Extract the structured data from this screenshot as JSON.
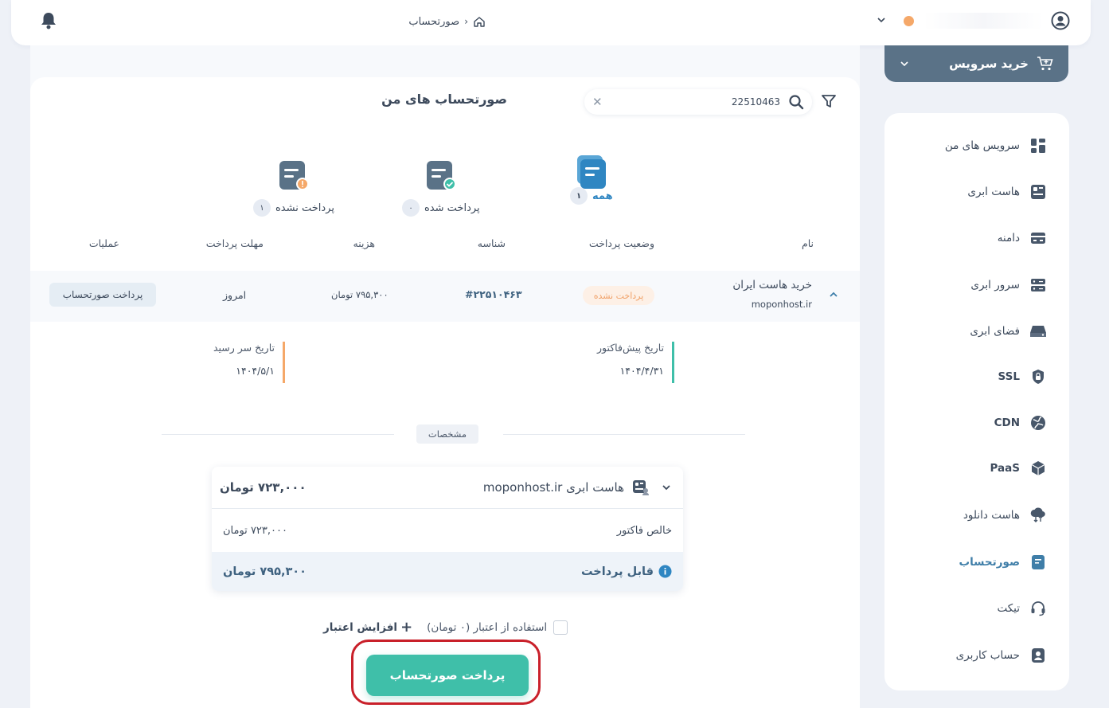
{
  "breadcrumb": {
    "current": "صورتحساب"
  },
  "buy": {
    "label": "خرید سرویس"
  },
  "sidebar": {
    "items": [
      {
        "label": "سرویس های من"
      },
      {
        "label": "هاست ابری"
      },
      {
        "label": "دامنه"
      },
      {
        "label": "سرور ابری"
      },
      {
        "label": "فضای ابری"
      },
      {
        "label": "SSL"
      },
      {
        "label": "CDN"
      },
      {
        "label": "PaaS"
      },
      {
        "label": "هاست دانلود"
      },
      {
        "label": "صورتحساب"
      },
      {
        "label": "تیکت"
      },
      {
        "label": "حساب کاربری"
      }
    ]
  },
  "main": {
    "title": "صورتحساب های من",
    "search_value": "22510463",
    "tabs": [
      {
        "label": "همه",
        "count": "۱"
      },
      {
        "label": "پرداخت شده",
        "count": "۰"
      },
      {
        "label": "پرداخت نشده",
        "count": "۱"
      }
    ],
    "columns": {
      "name": "نام",
      "status": "وضعیت پرداخت",
      "id": "شناسه",
      "cost": "هزینه",
      "deadline": "مهلت پرداخت",
      "actions": "عملیات"
    },
    "row": {
      "name": "خرید هاست ایران",
      "domain": "moponhost.ir",
      "status": "پرداخت نشده",
      "id": "#۲۲۵۱۰۴۶۳",
      "cost": "۷۹۵,۳۰۰ تومان",
      "deadline": "امروز",
      "action": "پرداخت صورتحساب"
    },
    "dates": {
      "proforma_label": "تاریخ پیش‌فاکتور",
      "proforma_value": "۱۴۰۴/۴/۳۱",
      "due_label": "تاریخ سر رسید",
      "due_value": "۱۴۰۴/۵/۱"
    },
    "spec_label": "مشخصات",
    "card": {
      "title": "هاست ابری moponhost.ir",
      "amount": "۷۲۳,۰۰۰ تومان",
      "net_label": "خالص فاکتور",
      "net_value": "۷۲۳,۰۰۰ تومان",
      "payable_label": "قابل پرداخت",
      "payable_value": "۷۹۵,۳۰۰ تومان"
    },
    "credit": {
      "use_label": "استفاده از اعتبار (۰ تومان)",
      "increase_label": "افزایش اعتبار"
    },
    "pay_button": "پرداخت صورتحساب"
  },
  "colors": {
    "accent": "#3fbfa9",
    "primary": "#5a7287",
    "warning": "#f5a869",
    "highlight": "#c9202a"
  }
}
